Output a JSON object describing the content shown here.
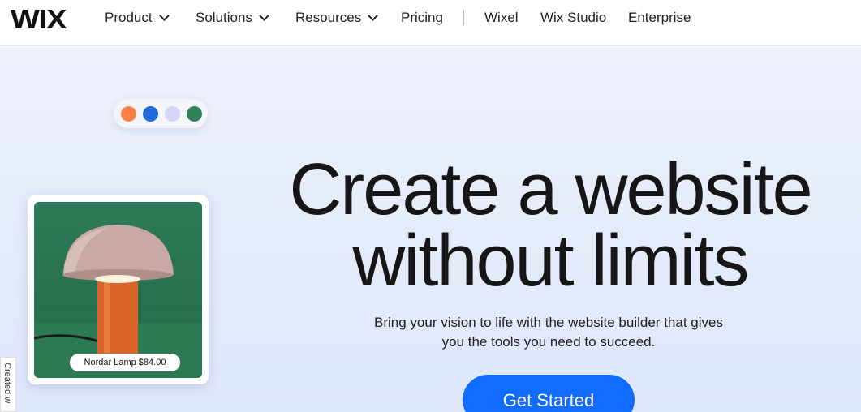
{
  "nav": {
    "logo": "WIX",
    "items": [
      {
        "label": "Product",
        "has_dropdown": true
      },
      {
        "label": "Solutions",
        "has_dropdown": true
      },
      {
        "label": "Resources",
        "has_dropdown": true
      },
      {
        "label": "Pricing",
        "has_dropdown": false
      },
      {
        "label": "Wixel",
        "has_dropdown": false
      },
      {
        "label": "Wix Studio",
        "has_dropdown": false
      },
      {
        "label": "Enterprise",
        "has_dropdown": false
      }
    ]
  },
  "hero": {
    "swatch_colors": [
      "#ff7f45",
      "#1f6bd9",
      "#d6d5f7",
      "#2e8058"
    ],
    "product_card": {
      "tag": "Nordar Lamp $84.00",
      "icon": "lamp-image"
    },
    "headline_line1": "Create a website",
    "headline_line2": "without limits",
    "subtext": "Bring your vision to life with the website builder that gives you the tools you need to succeed.",
    "cta_label": "Get Started"
  },
  "side_badge": {
    "text": "Created w"
  },
  "colors": {
    "accent": "#116dff",
    "hero_bg": "#e6ecfa"
  }
}
